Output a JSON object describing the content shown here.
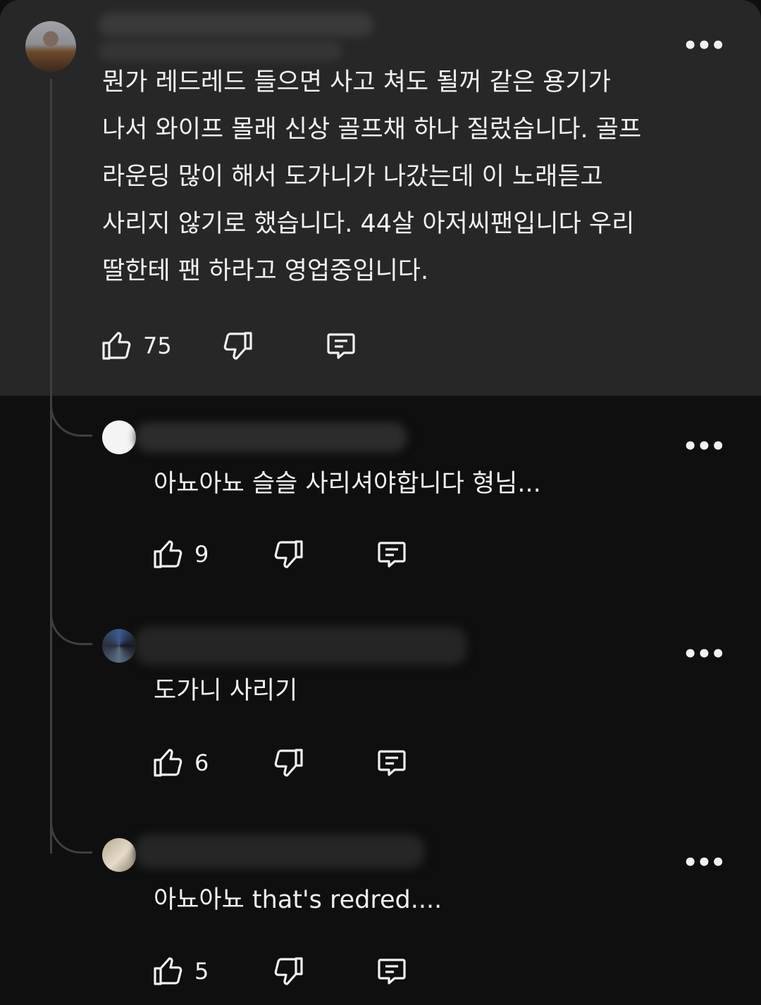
{
  "comment": {
    "text": "뭔가 레드레드 들으면 사고 쳐도 될꺼 같은 용기가\n나서 와이프 몰래 신상 골프채 하나 질렀습니다. 골프\n라운딩 많이 해서 도가니가 나갔는데 이 노래듣고\n사리지 않기로 했습니다. 44살 아저씨팬입니다 우리\n딸한테 팬 하라고 영업중입니다.",
    "likes": "75"
  },
  "replies": [
    {
      "text": "아뇨아뇨 슬슬 사리셔야합니다 형님...",
      "likes": "9"
    },
    {
      "text": "도가니 사리기",
      "likes": "6"
    },
    {
      "text": "아뇨아뇨 that's redred....",
      "likes": "5"
    }
  ],
  "icons": {
    "like": "thumbs-up-icon",
    "dislike": "thumbs-down-icon",
    "reply": "comment-icon",
    "more": "more-vert-icon"
  },
  "more_glyph": "•••"
}
